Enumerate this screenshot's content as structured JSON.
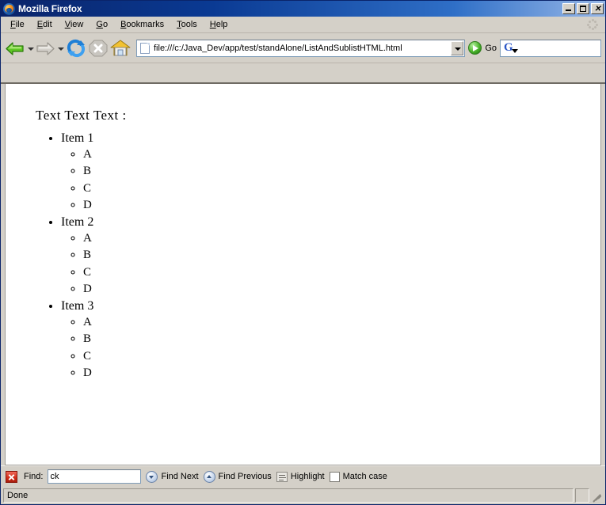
{
  "window": {
    "title": "Mozilla Firefox",
    "app_icon": "firefox-logo-icon",
    "controls": {
      "minimize": "minimize-button",
      "maximize": "maximize-button",
      "close_glyph": "✕"
    }
  },
  "menubar": {
    "items": [
      {
        "label": "File",
        "accel": "F"
      },
      {
        "label": "Edit",
        "accel": "E"
      },
      {
        "label": "View",
        "accel": "V"
      },
      {
        "label": "Go",
        "accel": "G"
      },
      {
        "label": "Bookmarks",
        "accel": "B"
      },
      {
        "label": "Tools",
        "accel": "T"
      },
      {
        "label": "Help",
        "accel": "H"
      }
    ],
    "throbber": "throbber-idle-icon"
  },
  "toolbar": {
    "back": "back-arrow-icon",
    "forward": "forward-arrow-icon",
    "reload": "reload-icon",
    "stop": "stop-icon",
    "home": "home-icon",
    "go_label": "Go"
  },
  "location": {
    "url": "file:///c:/Java_Dev/app/test/standAlone/ListAndSublistHTML.html",
    "page_icon": "page-document-icon",
    "dropdown": "chevron-down-icon"
  },
  "search": {
    "value": "",
    "engine_letter": "G",
    "engine_icon": "google-search-icon"
  },
  "page": {
    "heading": "Text Text Text :",
    "list": [
      {
        "label": "Item 1",
        "sub": [
          "A",
          "B",
          "C",
          "D"
        ]
      },
      {
        "label": "Item 2",
        "sub": [
          "A",
          "B",
          "C",
          "D"
        ]
      },
      {
        "label": "Item 3",
        "sub": [
          "A",
          "B",
          "C",
          "D"
        ]
      }
    ]
  },
  "findbar": {
    "close": "close-findbar-icon",
    "label": "Find:",
    "value": "ck",
    "find_next": "Find Next",
    "find_previous": "Find Previous",
    "highlight": "Highlight",
    "match_case": "Match case",
    "match_case_checked": false
  },
  "statusbar": {
    "status": "Done",
    "grip": "resize-grip-icon"
  },
  "colors": {
    "titlebar_start": "#0a246a",
    "titlebar_end": "#98b8e8",
    "chrome": "#d4d0c8",
    "content_bg": "#ffffff",
    "find_close_red": "#d02b18",
    "go_green": "#49b32a"
  }
}
